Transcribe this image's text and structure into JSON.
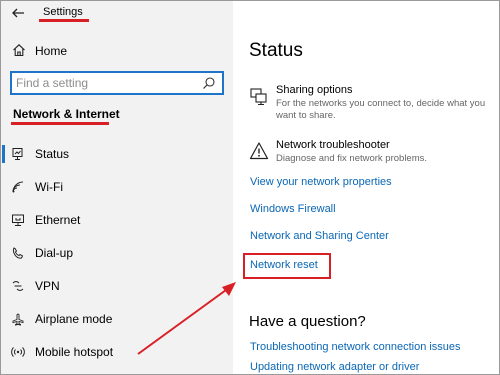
{
  "window": {
    "title": "Settings"
  },
  "sidebar": {
    "home_label": "Home",
    "search_placeholder": "Find a setting",
    "section_title": "Network & Internet",
    "items": [
      {
        "label": "Status",
        "icon": "status-icon",
        "active": true
      },
      {
        "label": "Wi-Fi",
        "icon": "wifi-icon"
      },
      {
        "label": "Ethernet",
        "icon": "ethernet-icon"
      },
      {
        "label": "Dial-up",
        "icon": "dialup-icon"
      },
      {
        "label": "VPN",
        "icon": "vpn-icon"
      },
      {
        "label": "Airplane mode",
        "icon": "airplane-icon"
      },
      {
        "label": "Mobile hotspot",
        "icon": "hotspot-icon"
      }
    ]
  },
  "main": {
    "title": "Status",
    "sharing": {
      "title": "Sharing options",
      "description": "For the networks you connect to, decide what you want to share."
    },
    "troubleshooter": {
      "title": "Network troubleshooter",
      "description": "Diagnose and fix network problems."
    },
    "links": [
      "View your network properties",
      "Windows Firewall",
      "Network and Sharing Center",
      "Network reset"
    ],
    "question_title": "Have a question?",
    "help_links": [
      "Troubleshooting network connection issues",
      "Updating network adapter or driver"
    ]
  },
  "colors": {
    "accent": "#1e74c8",
    "annotation": "#d91f26",
    "link": "#0b67b5"
  }
}
